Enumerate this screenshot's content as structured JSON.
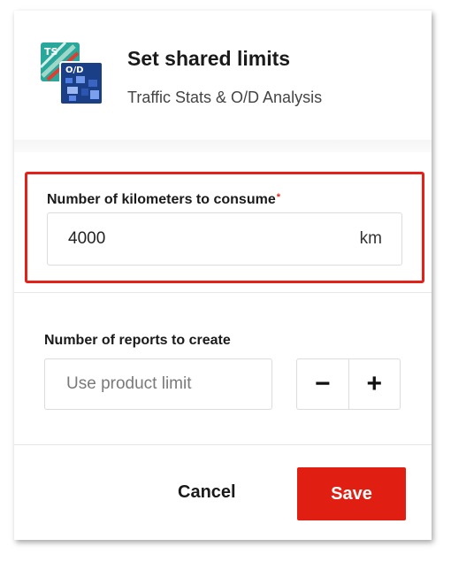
{
  "dialog": {
    "title": "Set shared limits",
    "subtitle": "Traffic Stats & O/D Analysis",
    "icon": {
      "name": "traffic-stats-od-app-icon",
      "badge_top": "TS",
      "badge_bottom": "O/D"
    }
  },
  "km_field": {
    "label": "Number of kilometers to consume",
    "required_mark": "*",
    "value": "4000",
    "unit": "km",
    "highlight_color": "#e32119"
  },
  "reports_field": {
    "label": "Number of reports to create",
    "placeholder": "Use product limit",
    "decrement_label": "−",
    "increment_label": "+"
  },
  "footer": {
    "cancel_label": "Cancel",
    "save_label": "Save",
    "save_color": "#e01e12"
  }
}
